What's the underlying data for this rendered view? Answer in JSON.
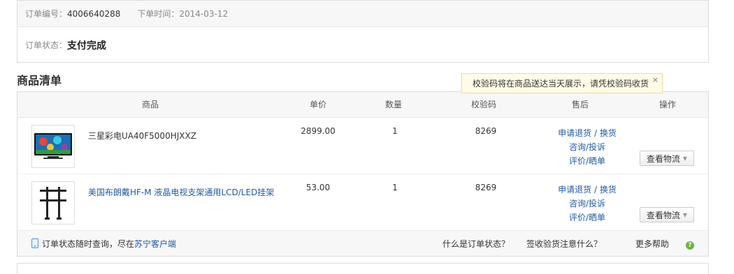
{
  "order": {
    "number_label": "订单编号：",
    "number": "4006640288",
    "date_label": "下单时间：",
    "date": "2014-03-12",
    "status_label": "订单状态：",
    "status": "支付完成"
  },
  "section_title": "商品清单",
  "tooltip": {
    "text": "校验码将在商品送达当天展示，请凭校验码收货",
    "close": "×"
  },
  "table": {
    "headers": {
      "product": "商品",
      "price": "单价",
      "qty": "数量",
      "code": "校验码",
      "after_sale": "售后",
      "action": "操作"
    },
    "rows": [
      {
        "name": "三星彩电UA40F5000HJXXZ",
        "price": "2899.00",
        "qty": "1",
        "code": "8269",
        "return": "申请退货 / 换货",
        "consult": "咨询/投诉",
        "review": "评价/晒单",
        "logistics": "查看物流"
      },
      {
        "name": "美国布朗戴HF-M 液晶电视支架通用LCD/LED挂架",
        "price": "53.00",
        "qty": "1",
        "code": "8269",
        "return": "申请退货 / 换货",
        "consult": "咨询/投诉",
        "review": "评价/晒单",
        "logistics": "查看物流"
      }
    ]
  },
  "footer": {
    "query_text": "订单状态随时查询，尽在",
    "client_link": "苏宁客户端",
    "what_status": "什么是订单状态？",
    "sign_note": "签收验货注意什么？",
    "more_help": "更多帮助",
    "help_icon": "question-icon",
    "phone_icon": "mobile-phone-icon"
  },
  "colors": {
    "link": "#1f5aa5",
    "header_bg": "#f7f7f7",
    "tooltip_bg": "#fffbe6",
    "help_green": "#6cb33f"
  }
}
